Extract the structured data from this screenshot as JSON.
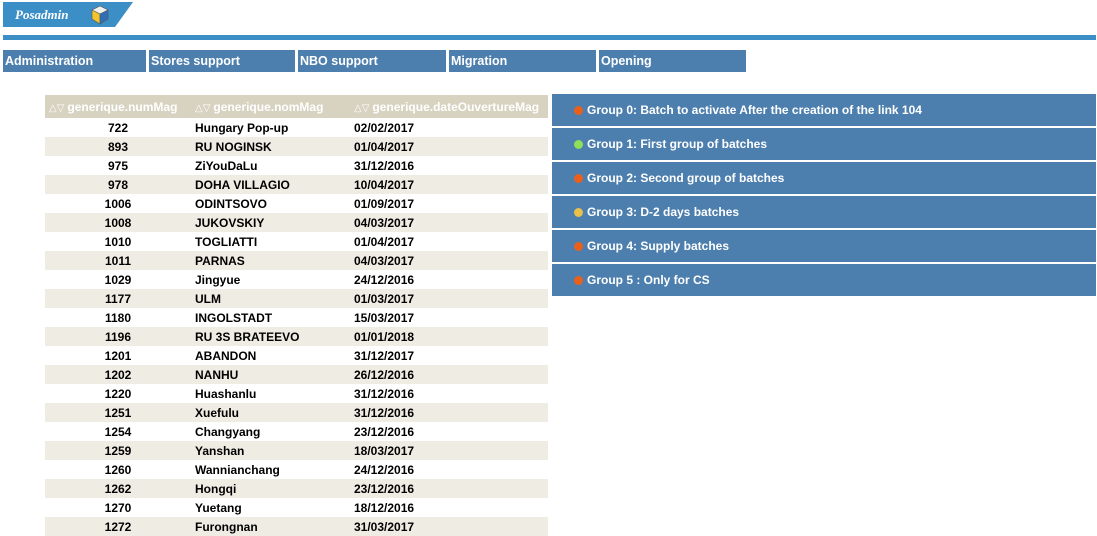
{
  "app": {
    "title": "Posadmin",
    "logo_icon": "cube-icon",
    "accent": "#3b8fc6",
    "nav_bg": "#4d7fae"
  },
  "nav": {
    "items": [
      {
        "label": "Administration"
      },
      {
        "label": "Stores support"
      },
      {
        "label": "NBO support"
      },
      {
        "label": "Migration"
      },
      {
        "label": "Opening"
      }
    ]
  },
  "table": {
    "sort_icon": "sort-arrows-icon",
    "columns": [
      "generique.numMag",
      "generique.nomMag",
      "generique.dateOuvertureMag"
    ],
    "rows": [
      [
        "722",
        "Hungary Pop-up",
        "02/02/2017"
      ],
      [
        "893",
        "RU NOGINSK",
        "01/04/2017"
      ],
      [
        "975",
        "ZiYouDaLu",
        "31/12/2016"
      ],
      [
        "978",
        "DOHA VILLAGIO",
        "10/04/2017"
      ],
      [
        "1006",
        "ODINTSOVO",
        "01/09/2017"
      ],
      [
        "1008",
        "JUKOVSKIY",
        "04/03/2017"
      ],
      [
        "1010",
        "TOGLIATTI",
        "01/04/2017"
      ],
      [
        "1011",
        "PARNAS",
        "04/03/2017"
      ],
      [
        "1029",
        "Jingyue",
        "24/12/2016"
      ],
      [
        "1177",
        "ULM",
        "01/03/2017"
      ],
      [
        "1180",
        "INGOLSTADT",
        "15/03/2017"
      ],
      [
        "1196",
        "RU 3S BRATEEVO",
        "01/01/2018"
      ],
      [
        "1201",
        "ABANDON",
        "31/12/2017"
      ],
      [
        "1202",
        "NANHU",
        "26/12/2016"
      ],
      [
        "1220",
        "Huashanlu",
        "31/12/2016"
      ],
      [
        "1251",
        "Xuefulu",
        "31/12/2016"
      ],
      [
        "1254",
        "Changyang",
        "23/12/2016"
      ],
      [
        "1259",
        "Yanshan",
        "18/03/2017"
      ],
      [
        "1260",
        "Wannianchang",
        "24/12/2016"
      ],
      [
        "1262",
        "Hongqi",
        "23/12/2016"
      ],
      [
        "1270",
        "Yuetang",
        "18/12/2016"
      ],
      [
        "1272",
        "Furongnan",
        "31/03/2017"
      ]
    ]
  },
  "groups": [
    {
      "label": "Group 0: Batch to activate After the creation of the link 104",
      "status_color": "#e8601c"
    },
    {
      "label": "Group 1: First group of batches",
      "status_color": "#8ee05a"
    },
    {
      "label": "Group 2: Second group of batches",
      "status_color": "#e8601c"
    },
    {
      "label": "Group 3: D-2 days batches",
      "status_color": "#e8c04a"
    },
    {
      "label": "Group 4: Supply batches",
      "status_color": "#e8601c"
    },
    {
      "label": "Group 5 : Only for CS",
      "status_color": "#e8601c"
    }
  ]
}
